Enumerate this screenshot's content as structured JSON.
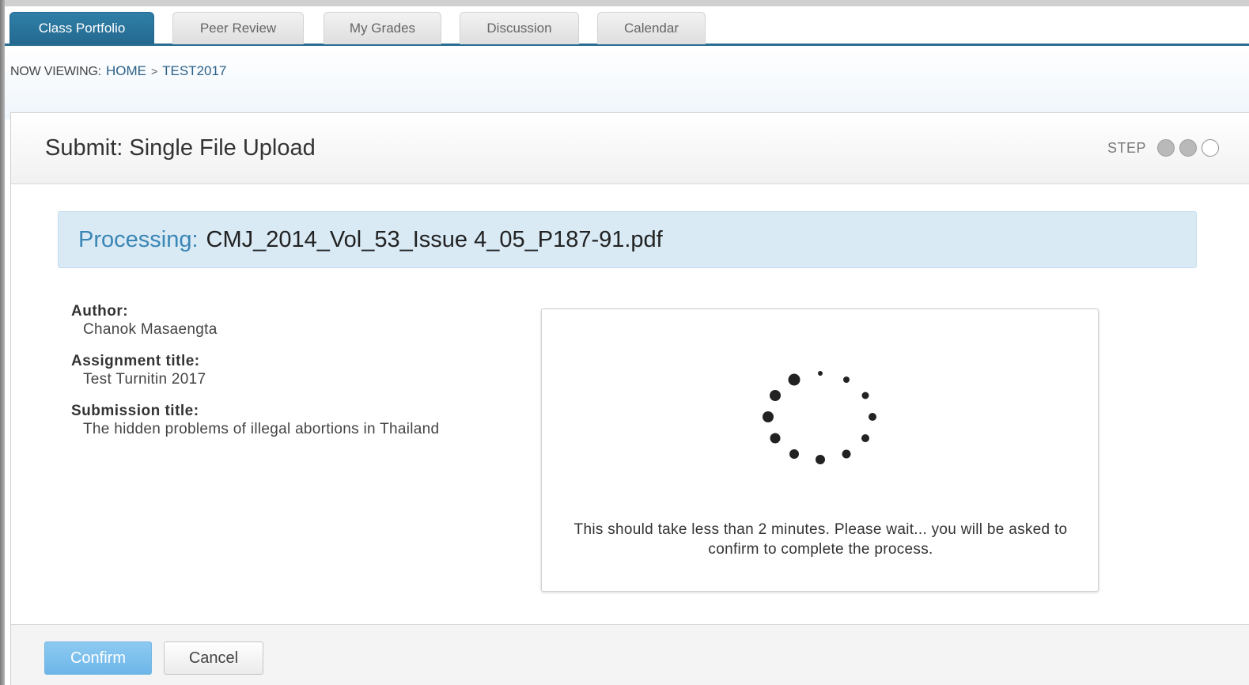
{
  "tabs": [
    {
      "label": "Class Portfolio",
      "active": true
    },
    {
      "label": "Peer Review",
      "active": false
    },
    {
      "label": "My Grades",
      "active": false
    },
    {
      "label": "Discussion",
      "active": false
    },
    {
      "label": "Calendar",
      "active": false
    }
  ],
  "breadcrumb": {
    "label": "NOW VIEWING:",
    "items": [
      "HOME",
      "TEST2017"
    ],
    "separator": ">"
  },
  "panel": {
    "title": "Submit: Single File Upload",
    "step_label": "STEP",
    "steps_completed": 2,
    "steps_total": 3
  },
  "processing": {
    "label": "Processing:",
    "filename": "CMJ_2014_Vol_53_Issue 4_05_P187-91.pdf"
  },
  "meta": {
    "author_label": "Author:",
    "author": "Chanok Masaengta",
    "assignment_label": "Assignment title:",
    "assignment": "Test Turnitin 2017",
    "submission_label": "Submission title:",
    "submission": "The hidden problems of illegal abortions in Thailand"
  },
  "loader": {
    "icon": "loading-spinner-icon",
    "text": "This should take less than 2 minutes. Please wait... you will be asked to confirm to complete the process."
  },
  "buttons": {
    "confirm": "Confirm",
    "cancel": "Cancel"
  },
  "colors": {
    "tab_active": "#2a6e93",
    "processing_bg": "#d9eaf5",
    "processing_label": "#3a86b5",
    "confirm_bg": "#7dc0ee"
  }
}
